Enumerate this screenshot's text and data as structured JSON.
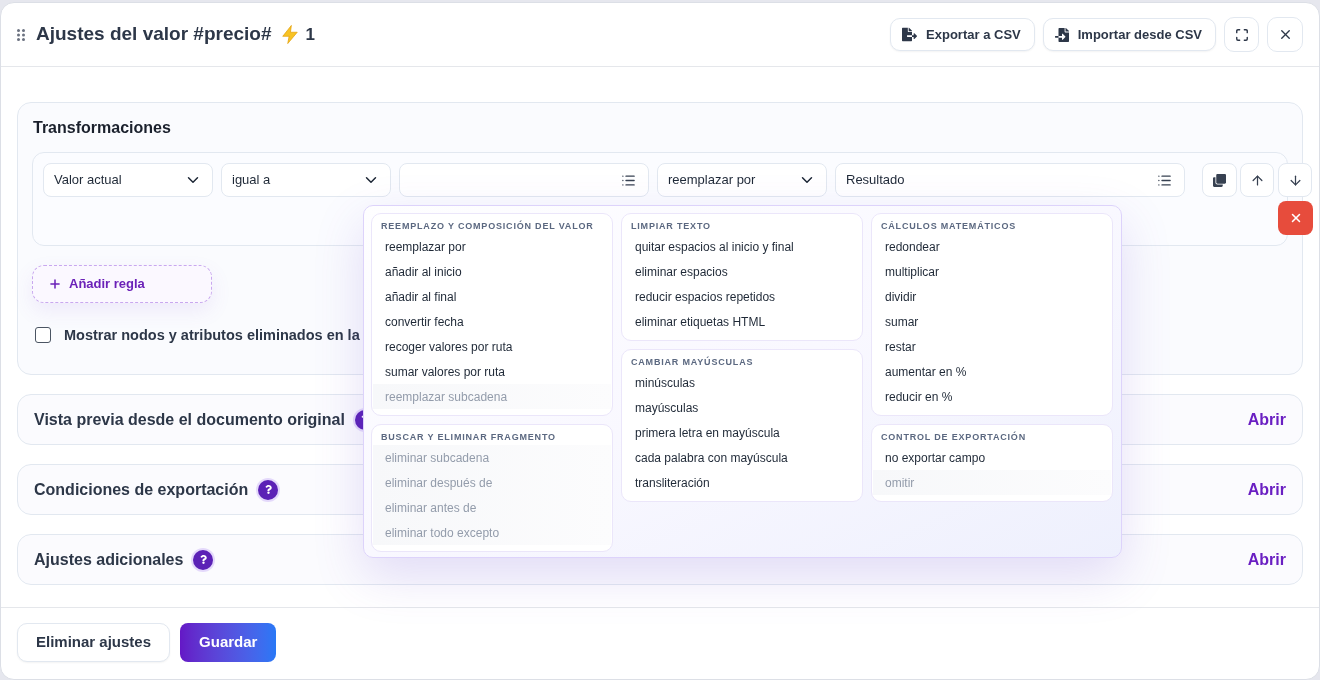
{
  "dialog": {
    "title": "Ajustes del valor #precio#",
    "rule_count": "1",
    "header_buttons": [
      {
        "kind": "export",
        "label": "Exportar a CSV"
      },
      {
        "kind": "import",
        "label": "Importar desde CSV"
      }
    ]
  },
  "transformations": {
    "title": "Transformaciones",
    "rule": {
      "fields": [
        {
          "kind": "select",
          "value": "Valor actual"
        },
        {
          "kind": "select",
          "value": "igual a"
        },
        {
          "kind": "list_input"
        },
        {
          "kind": "select",
          "value": "reemplazar por"
        },
        {
          "kind": "list_input",
          "value": "Resultado"
        }
      ]
    },
    "add_rule": "Añadir regla",
    "show_removed": {
      "label": "Mostrar nodos y atributos eliminados en la",
      "checked": false
    }
  },
  "operation_menu": {
    "columns": [
      {
        "groups": [
          {
            "title": "REEMPLAZO Y COMPOSICIÓN DEL VALOR",
            "items": [
              {
                "label": "reemplazar por",
                "disabled": false
              },
              {
                "label": "añadir al inicio",
                "disabled": false
              },
              {
                "label": "añadir al final",
                "disabled": false
              },
              {
                "label": "convertir fecha",
                "disabled": false
              },
              {
                "label": "recoger valores por ruta",
                "disabled": false
              },
              {
                "label": "sumar valores por ruta",
                "disabled": false
              },
              {
                "label": "reemplazar subcadena",
                "disabled": true
              }
            ]
          },
          {
            "title": "BUSCAR Y ELIMINAR FRAGMENTO",
            "items": [
              {
                "label": "eliminar subcadena",
                "disabled": true
              },
              {
                "label": "eliminar después de",
                "disabled": true
              },
              {
                "label": "eliminar antes de",
                "disabled": true
              },
              {
                "label": "eliminar todo excepto",
                "disabled": true
              }
            ]
          }
        ]
      },
      {
        "groups": [
          {
            "title": "LIMPIAR TEXTO",
            "items": [
              {
                "label": "quitar espacios al inicio y final",
                "disabled": false
              },
              {
                "label": "eliminar espacios",
                "disabled": false
              },
              {
                "label": "reducir espacios repetidos",
                "disabled": false
              },
              {
                "label": "eliminar etiquetas HTML",
                "disabled": false
              }
            ]
          },
          {
            "title": "CAMBIAR MAYÚSCULAS",
            "items": [
              {
                "label": "minúsculas",
                "disabled": false
              },
              {
                "label": "mayúsculas",
                "disabled": false
              },
              {
                "label": "primera letra en mayúscula",
                "disabled": false
              },
              {
                "label": "cada palabra con mayúscula",
                "disabled": false
              },
              {
                "label": "transliteración",
                "disabled": false
              }
            ]
          }
        ]
      },
      {
        "groups": [
          {
            "title": "CÁLCULOS MATEMÁTICOS",
            "items": [
              {
                "label": "redondear",
                "disabled": false
              },
              {
                "label": "multiplicar",
                "disabled": false
              },
              {
                "label": "dividir",
                "disabled": false
              },
              {
                "label": "sumar",
                "disabled": false
              },
              {
                "label": "restar",
                "disabled": false
              },
              {
                "label": "aumentar en %",
                "disabled": false
              },
              {
                "label": "reducir en %",
                "disabled": false
              }
            ]
          },
          {
            "title": "CONTROL DE EXPORTACIÓN",
            "items": [
              {
                "label": "no exportar campo",
                "disabled": false
              },
              {
                "label": "omitir",
                "disabled": true
              }
            ]
          }
        ]
      }
    ]
  },
  "sections": [
    {
      "title": "Vista previa desde el documento original",
      "action": "Abrir"
    },
    {
      "title": "Condiciones de exportación",
      "action": "Abrir"
    },
    {
      "title": "Ajustes adicionales",
      "action": "Abrir"
    }
  ],
  "footer": {
    "buttons": [
      {
        "kind": "secondary",
        "label": "Eliminar ajustes"
      },
      {
        "kind": "primary",
        "label": "Guardar"
      }
    ]
  }
}
